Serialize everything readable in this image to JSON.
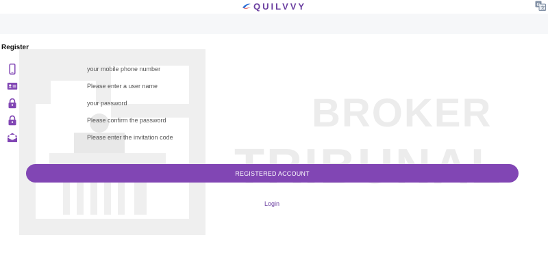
{
  "header": {
    "logo_text": "QUILVVY",
    "logo_icon": "brand-swoosh-icon",
    "language_icon": "translate-icon",
    "brand_color": "#6b3fa0"
  },
  "page": {
    "title": "Register"
  },
  "form": {
    "fields": [
      {
        "name": "phone",
        "icon": "mobile-phone-icon",
        "placeholder": "your mobile phone number"
      },
      {
        "name": "username",
        "icon": "id-card-icon",
        "placeholder": "Please enter a user name"
      },
      {
        "name": "password",
        "icon": "lock-icon",
        "placeholder": "your password"
      },
      {
        "name": "confirm_password",
        "icon": "lock-icon",
        "placeholder": "Please confirm the password"
      },
      {
        "name": "invitation_code",
        "icon": "envelope-icon",
        "placeholder": "Please enter the invitation code"
      }
    ],
    "submit_label": "REGISTERED ACCOUNT",
    "login_label": "Login"
  },
  "watermark": {
    "line1": "BROKER",
    "line2": "TRIBUNAL"
  },
  "colors": {
    "accent": "#8146b4",
    "icon": "#8146b4",
    "band": "#f6f7f9"
  }
}
